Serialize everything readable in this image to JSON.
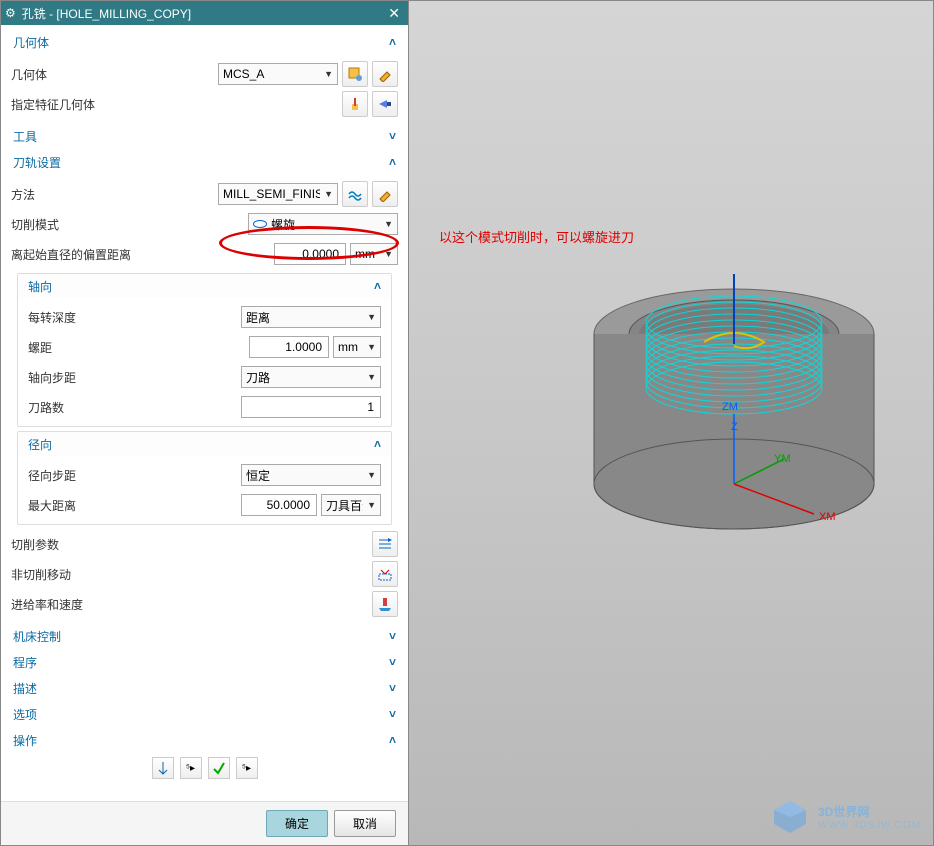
{
  "window": {
    "title": "孔铣 - [HOLE_MILLING_COPY]"
  },
  "sections": {
    "geometry": {
      "title": "几何体"
    },
    "tool": {
      "title": "工具"
    },
    "path": {
      "title": "刀轨设置"
    },
    "machine": {
      "title": "机床控制"
    },
    "program": {
      "title": "程序"
    },
    "description": {
      "title": "描述"
    },
    "options": {
      "title": "选项"
    },
    "actions": {
      "title": "操作"
    }
  },
  "geometry": {
    "label": "几何体",
    "value": "MCS_A",
    "featureLabel": "指定特征几何体"
  },
  "path": {
    "methodLabel": "方法",
    "methodValue": "MILL_SEMI_FINISH",
    "cutModeLabel": "切削模式",
    "cutModeValue": "螺旋",
    "offsetLabel": "离起始直径的偏置距离",
    "offsetValue": "0.0000",
    "offsetUnit": "mm",
    "axial": {
      "title": "轴向",
      "perRevLabel": "每转深度",
      "perRevValue": "距离",
      "pitchLabel": "螺距",
      "pitchValue": "1.0000",
      "pitchUnit": "mm",
      "stepLabel": "轴向步距",
      "stepValue": "刀路",
      "passesLabel": "刀路数",
      "passesValue": "1"
    },
    "radial": {
      "title": "径向",
      "stepLabel": "径向步距",
      "stepValue": "恒定",
      "maxDistLabel": "最大距离",
      "maxDistValue": "50.0000",
      "maxDistUnit": "刀具百分"
    },
    "cutParamsLabel": "切削参数",
    "nonCutLabel": "非切削移动",
    "feedSpeedLabel": "进给率和速度"
  },
  "annotation": "以这个模式切削时，可以螺旋进刀",
  "axes": {
    "zm": "ZM",
    "z": "Z",
    "ym": "YM",
    "xm": "XM"
  },
  "footer": {
    "ok": "确定",
    "cancel": "取消"
  },
  "watermark": {
    "main": "3D世界网",
    "sub": "WWW.3DSJW.COM"
  }
}
